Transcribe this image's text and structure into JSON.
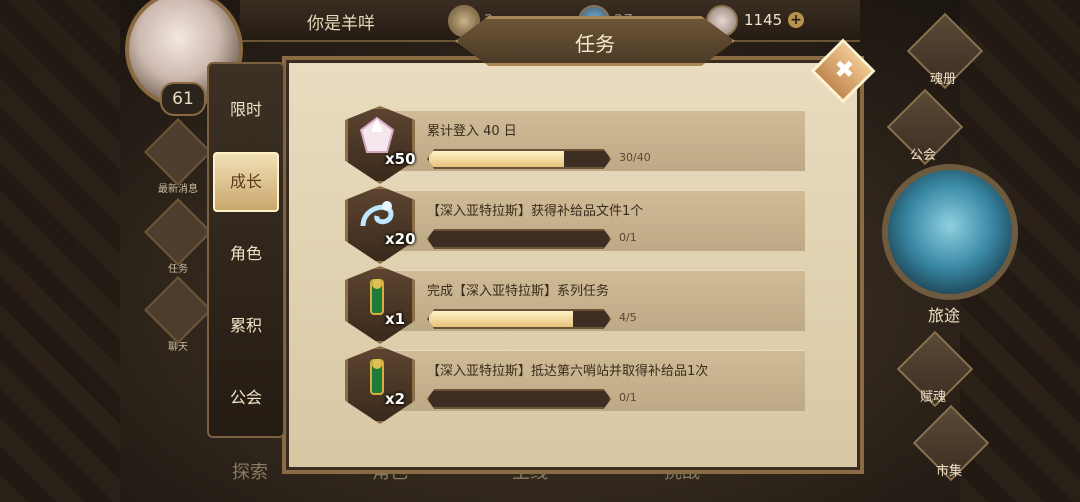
{
  "header": {
    "player_name": "你是羊咩",
    "resource_1": "2",
    "resource_2": "27",
    "resource_3": "1145",
    "level": "61"
  },
  "left_menu": [
    {
      "label": "最新消息",
      "icon": "scroll-icon"
    },
    {
      "label": "任务",
      "icon": "quest-icon"
    },
    {
      "label": "聊天",
      "icon": "chat-bubble-icon"
    }
  ],
  "bottom_tabs": [
    "探索",
    "角色",
    "主线",
    "挑战"
  ],
  "right_nav": {
    "soul_book": "魂册",
    "guild": "公会",
    "journey": "旅途",
    "fusion": "赋魂",
    "market": "市集"
  },
  "dialog": {
    "title": "任务",
    "close_glyph": "✖",
    "tabs": [
      {
        "label": "限时",
        "active": false
      },
      {
        "label": "成长",
        "active": true
      },
      {
        "label": "角色",
        "active": false
      },
      {
        "label": "累积",
        "active": false
      },
      {
        "label": "公会",
        "active": false
      }
    ],
    "tasks": [
      {
        "desc": "累计登入 40 日",
        "qty": "x50",
        "progress_text": "30/40",
        "progress": 0.75,
        "item_icon": "crystal-gem-icon"
      },
      {
        "desc": "【深入亚特拉斯】获得补给品文件1个",
        "qty": "x20",
        "progress_text": "0/1",
        "progress": 0,
        "item_icon": "spirit-swirl-icon"
      },
      {
        "desc": "完成【深入亚特拉斯】系列任务",
        "qty": "x1",
        "progress_text": "4/5",
        "progress": 0.8,
        "item_icon": "green-scroll-icon"
      },
      {
        "desc": "【深入亚特拉斯】抵达第六哨站并取得补给品1次",
        "qty": "x2",
        "progress_text": "0/1",
        "progress": 0,
        "item_icon": "green-scroll-icon"
      }
    ]
  },
  "colors": {
    "accent": "#c9a86c",
    "panel": "#e0d0ae",
    "frame": "#8a6c44"
  }
}
